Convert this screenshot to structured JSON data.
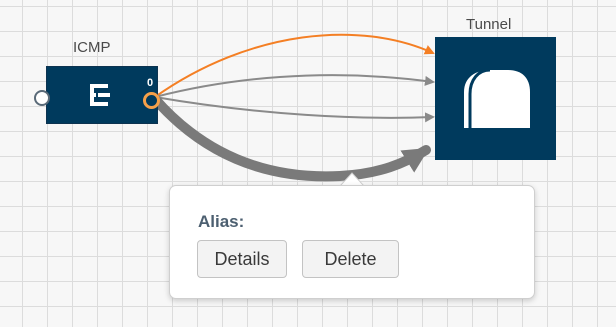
{
  "nodes": {
    "icmp": {
      "label": "ICMP",
      "output_port_label": "0",
      "icon": "filter-icon"
    },
    "tunnel": {
      "label": "Tunnel",
      "icon": "tunnel-icon"
    }
  },
  "popover": {
    "alias_label": "Alias:",
    "details_button": "Details",
    "delete_button": "Delete"
  },
  "colors": {
    "node_fill": "#003a5d",
    "highlight_edge": "#f47f24",
    "edge": "#8a8a8a",
    "selected_edge": "#7a7a7a",
    "port_ring": "#f5a04a"
  }
}
